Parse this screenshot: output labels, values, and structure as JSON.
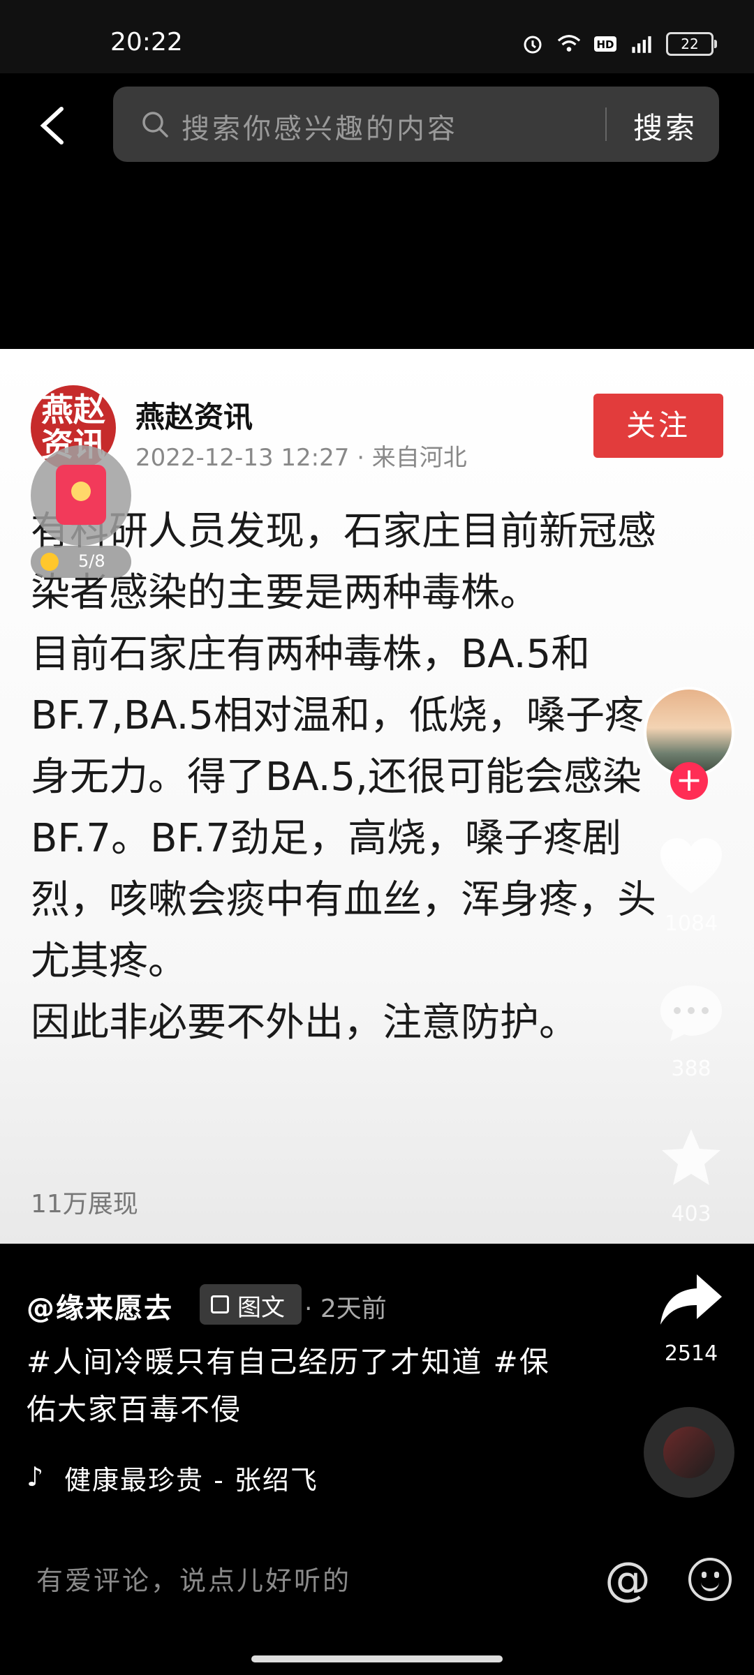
{
  "status_bar": {
    "time": "20:22",
    "battery": "22"
  },
  "search": {
    "placeholder": "搜索你感兴趣的内容",
    "button": "搜索"
  },
  "post": {
    "author": "燕赵资讯",
    "logo_text_1": "燕赵",
    "logo_text_2": "资讯",
    "meta": "2022-12-13 12:27 · 来自河北",
    "follow": "关注",
    "paragraphs": [
      "有科研人员发现，石家庄目前新冠感染者感染的主要是两种毒株。",
      "目前石家庄有两种毒株，BA.5和BF.7,BA.5相对温和，低烧，嗓子疼，身无力。得了BA.5,还很可能会感染BF.7。BF.7劲足，高烧，嗓子疼剧烈，咳嗽会痰中有血丝，浑身疼，头尤其疼。",
      "因此非必要不外出，注意防护。"
    ],
    "views": "11万展现"
  },
  "reward": {
    "progress": "5/8"
  },
  "actions": {
    "likes": "1084",
    "comments": "388",
    "favorites": "403",
    "shares": "2514"
  },
  "video_info": {
    "handle": "@缘来愿去",
    "type": "图文",
    "time": "· 2天前",
    "caption": "#人间冷暖只有自己经历了才知道 #保佑大家百毒不侵",
    "music": "健康最珍贵 - 张绍飞"
  },
  "comment_bar": {
    "placeholder": "有爱评论，说点儿好听的"
  },
  "colors": {
    "follow_button": "#e23c3c",
    "plus_badge": "#ff2d55"
  }
}
